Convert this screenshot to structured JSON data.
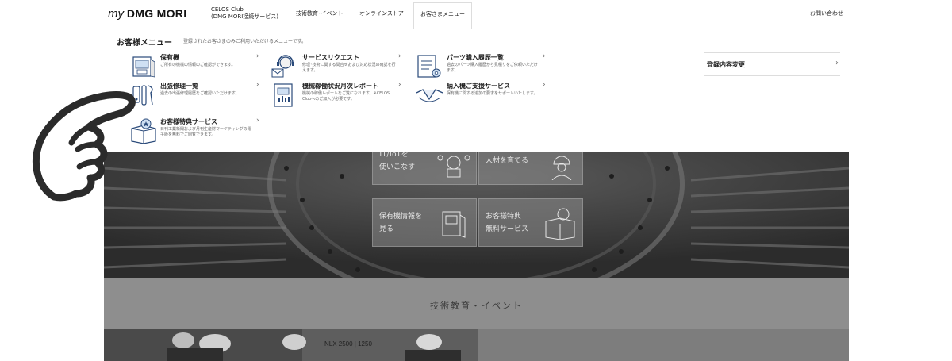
{
  "header": {
    "logo_my": "my",
    "logo_brand": "DMG MORI",
    "celos_line1": "CELOS Club",
    "celos_line2": "(DMG MORI接続サービス)",
    "nav": [
      {
        "label": "技術教育･イベント"
      },
      {
        "label": "オンラインストア"
      },
      {
        "label": "お客さまメニュー"
      }
    ],
    "contact_label": "お問い合わせ"
  },
  "menu": {
    "title": "お客様メニュー",
    "description": "登録されたお客さまのみご利用いただけるメニューです。",
    "items": [
      {
        "title": "保有機",
        "desc": "ご所有の機械の情報のご確認ができます。",
        "icon": "machine-catalog-icon"
      },
      {
        "title": "サービスリクエスト",
        "desc": "修理･技術に関する問合せおよび対応状況の確認を行えます。",
        "icon": "headset-mail-icon"
      },
      {
        "title": "パーツ購入履歴一覧",
        "desc": "過去のパーツ購入履歴から見積りをご依頼いただけます。",
        "icon": "parts-list-icon"
      },
      {
        "title": "出張修理一覧",
        "desc": "過去の出張修理履歴をご確認いただけます。",
        "icon": "tools-icon"
      },
      {
        "title": "機械稼働状況月次レポート",
        "desc": "機械の稼働レポートをご覧になれます。※CELOS Clubへのご加入が必要です。",
        "icon": "report-icon"
      },
      {
        "title": "納入機ご支援サービス",
        "desc": "保有機に関する追加の要求をサポートいたします。",
        "icon": "handshake-icon"
      },
      {
        "title": "お客様特典サービス",
        "desc": "日刊工業新聞および月刊生産財マーケティングの電子版を無料でご閲覧できます。",
        "icon": "gift-box-icon"
      }
    ],
    "registration_label": "登録内容変更",
    "chevron": "›"
  },
  "background": {
    "tiles": [
      {
        "text": "IT/IoTを\n使いこなす"
      },
      {
        "text": "人材を育てる"
      },
      {
        "text": "保有機情報を\n見る"
      },
      {
        "text": "お客様特典\n無料サービス"
      }
    ],
    "section_title": "技術教育・イベント",
    "photo_caption": "NLX 2500 | 1250"
  },
  "colors": {
    "overlay": "#3a3a3a",
    "band": "#8e8e8e",
    "text": "#222222",
    "muted": "#666666"
  }
}
